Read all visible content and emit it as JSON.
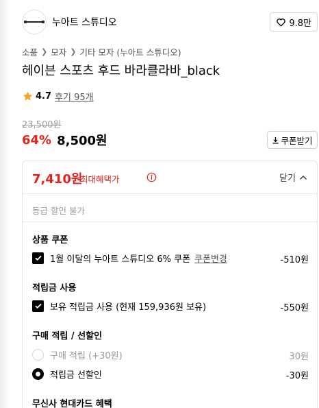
{
  "brand": {
    "name": "누아트 스튜디오",
    "likes": "9.8만"
  },
  "breadcrumb": [
    "소품",
    "모자",
    "기타 모자 (누아트 스튜디오)"
  ],
  "product": {
    "title": "헤이븐 스포츠 후드 바라클라바_black",
    "rating": "4.7",
    "review_text": "후기 95개",
    "original_price": "23,500원",
    "discount_rate": "64%",
    "sale_price": "8,500원"
  },
  "coupon_button": {
    "label": "쿠폰받기"
  },
  "benefits": {
    "max_price": "7,410원",
    "max_label": "최대혜택가",
    "close_label": "닫기",
    "grade_note": "등급 할인 불가",
    "coupon_section": {
      "title": "상품 쿠폰",
      "item": "1월 이달의 누아트 스튜디오 6% 쿠폰",
      "change_link": "쿠폰변경",
      "amount": "-510원"
    },
    "points_section": {
      "title": "적립금 사용",
      "item": "보유 적립금 사용 (현재 159,936원 보유)",
      "amount": "-550원"
    },
    "purchase_section": {
      "title": "구매 적립 / 선할인",
      "options": [
        {
          "label": "구매 적립 (+30원)",
          "amount": "30원",
          "selected": false
        },
        {
          "label": "적립금 선할인",
          "amount": "-30원",
          "selected": true
        }
      ]
    },
    "card_section": {
      "title": "무신사 현대카드 혜택"
    }
  },
  "colors": {
    "accent": "#e4211b",
    "text": "#000000",
    "muted": "#999999",
    "border": "#e6e6e6"
  }
}
